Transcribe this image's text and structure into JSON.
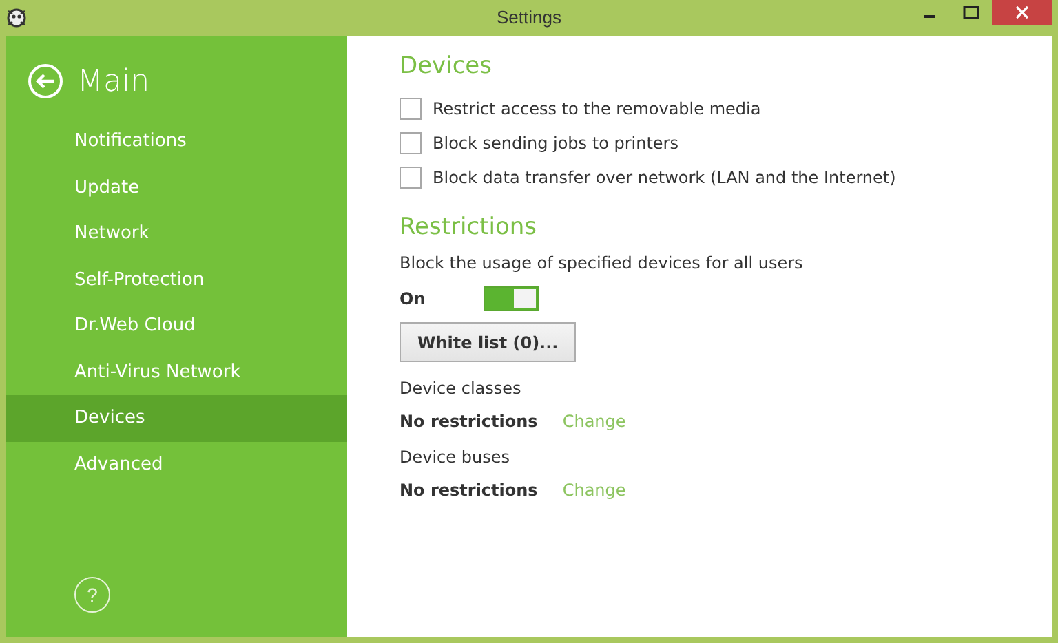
{
  "window": {
    "title": "Settings"
  },
  "sidebar": {
    "title": "Main",
    "items": [
      {
        "label": "Notifications",
        "selected": false
      },
      {
        "label": "Update",
        "selected": false
      },
      {
        "label": "Network",
        "selected": false
      },
      {
        "label": "Self-Protection",
        "selected": false
      },
      {
        "label": "Dr.Web Cloud",
        "selected": false
      },
      {
        "label": "Anti-Virus Network",
        "selected": false
      },
      {
        "label": "Devices",
        "selected": true
      },
      {
        "label": "Advanced",
        "selected": false
      }
    ],
    "help": "?"
  },
  "devices": {
    "title": "Devices",
    "options": [
      {
        "label": "Restrict access to the removable media",
        "checked": false
      },
      {
        "label": "Block sending jobs to printers",
        "checked": false
      },
      {
        "label": "Block data transfer over network (LAN and the Internet)",
        "checked": false
      }
    ]
  },
  "restrictions": {
    "title": "Restrictions",
    "description": "Block the usage of specified devices for all users",
    "toggle": {
      "label": "On",
      "on": true
    },
    "button": "White list (0)...",
    "groups": [
      {
        "label": "Device classes",
        "value": "No restrictions",
        "link": "Change"
      },
      {
        "label": "Device buses",
        "value": "No restrictions",
        "link": "Change"
      }
    ]
  }
}
